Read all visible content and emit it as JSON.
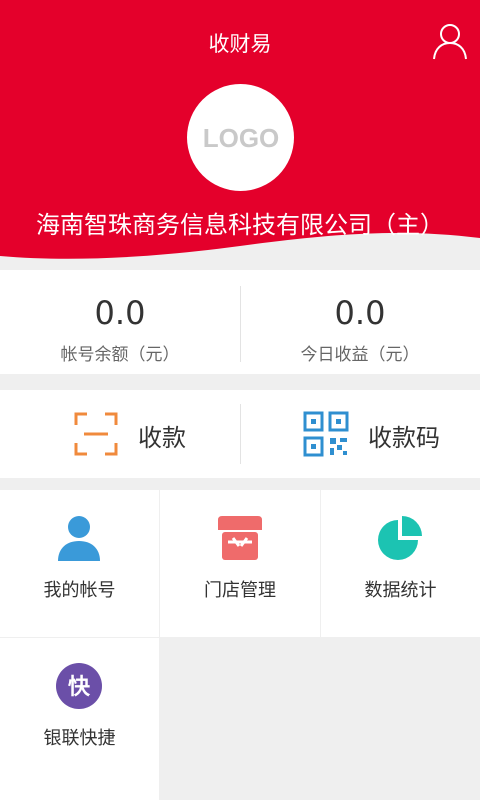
{
  "header": {
    "title": "收财易",
    "logo_text": "LOGO",
    "company_name": "海南智珠商务信息科技有限公司（主）",
    "profile_icon": "user-outline-icon",
    "brand_color": "#e4002b"
  },
  "stats": [
    {
      "value": "0.0",
      "label": "帐号余额（元）"
    },
    {
      "value": "0.0",
      "label": "今日收益（元）"
    }
  ],
  "actions": [
    {
      "label": "收款",
      "icon": "scan-icon",
      "color": "#f08a3c"
    },
    {
      "label": "收款码",
      "icon": "qr-code-icon",
      "color": "#2f8fd0"
    }
  ],
  "grid": [
    {
      "label": "我的帐号",
      "icon": "account-icon",
      "color": "#3a9ad9"
    },
    {
      "label": "门店管理",
      "icon": "store-icon",
      "color": "#ef6b6b"
    },
    {
      "label": "数据统计",
      "icon": "pie-chart-icon",
      "color": "#1cc3b2"
    },
    {
      "label": "银联快捷",
      "icon": "unionpay-quick-icon",
      "color": "#6b4fa8",
      "icon_text": "快"
    }
  ]
}
